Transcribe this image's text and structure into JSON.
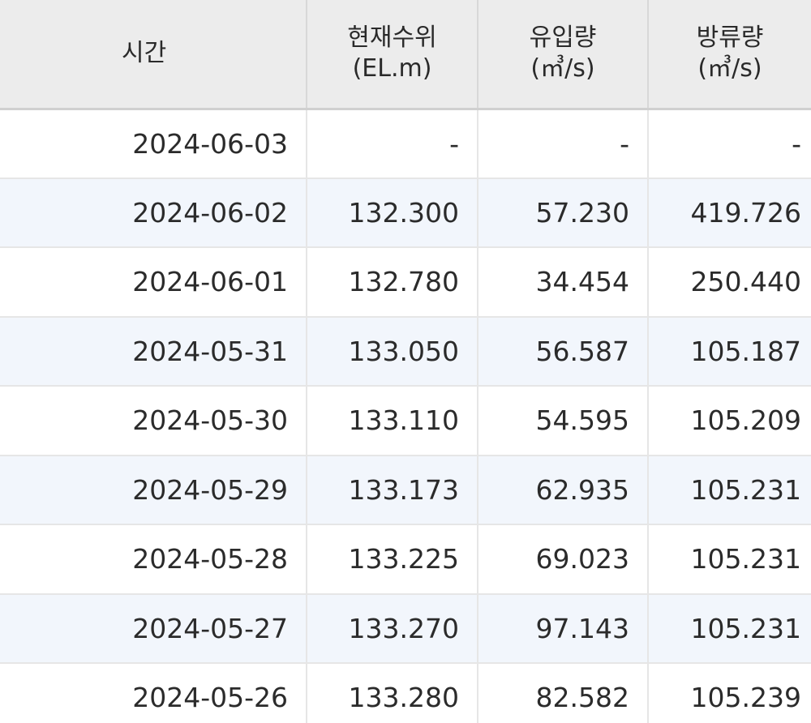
{
  "table": {
    "headers": {
      "time": "시간",
      "level_line1": "현재수위",
      "level_line2": "(EL.m)",
      "inflow_line1": "유입량",
      "inflow_line2": "(㎥/s)",
      "outflow_line1": "방류량",
      "outflow_line2": "(㎥/s)"
    },
    "rows": [
      {
        "time": "2024-06-03",
        "level": "-",
        "inflow": "-",
        "outflow": "-"
      },
      {
        "time": "2024-06-02",
        "level": "132.300",
        "inflow": "57.230",
        "outflow": "419.726"
      },
      {
        "time": "2024-06-01",
        "level": "132.780",
        "inflow": "34.454",
        "outflow": "250.440"
      },
      {
        "time": "2024-05-31",
        "level": "133.050",
        "inflow": "56.587",
        "outflow": "105.187"
      },
      {
        "time": "2024-05-30",
        "level": "133.110",
        "inflow": "54.595",
        "outflow": "105.209"
      },
      {
        "time": "2024-05-29",
        "level": "133.173",
        "inflow": "62.935",
        "outflow": "105.231"
      },
      {
        "time": "2024-05-28",
        "level": "133.225",
        "inflow": "69.023",
        "outflow": "105.231"
      },
      {
        "time": "2024-05-27",
        "level": "133.270",
        "inflow": "97.143",
        "outflow": "105.231"
      },
      {
        "time": "2024-05-26",
        "level": "133.280",
        "inflow": "82.582",
        "outflow": "105.239"
      }
    ]
  }
}
